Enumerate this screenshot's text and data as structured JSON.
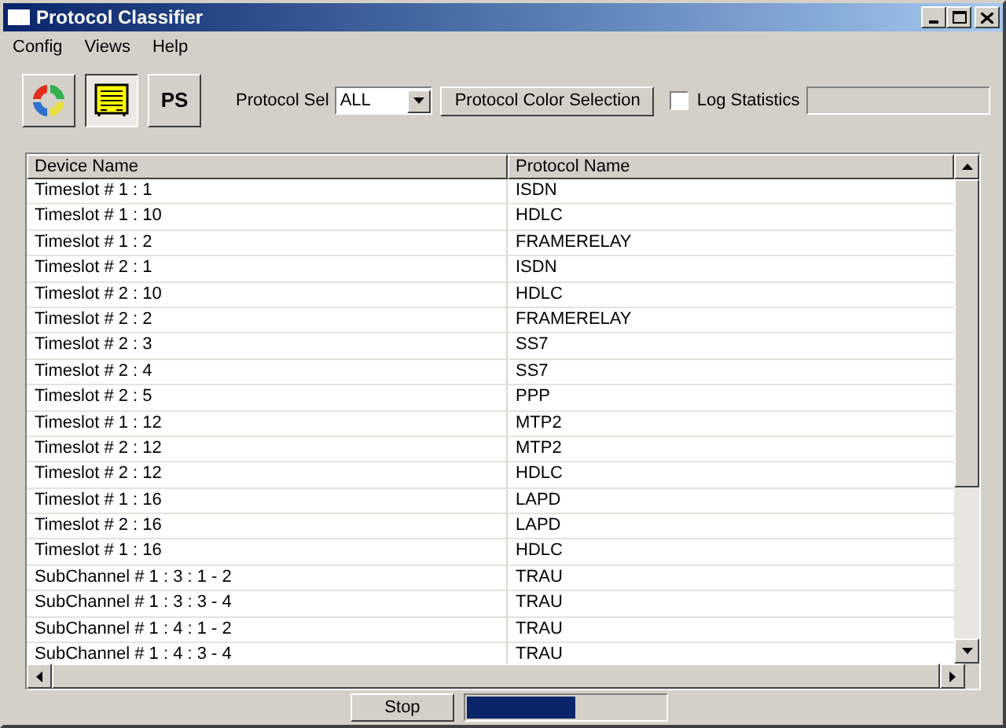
{
  "window": {
    "title": "Protocol Classifier"
  },
  "menu": [
    "Config",
    "Views",
    "Help"
  ],
  "toolbar": {
    "tools": [
      {
        "kind": "cycle",
        "selected": false
      },
      {
        "kind": "list",
        "selected": true
      },
      {
        "kind": "text",
        "label": "PS",
        "selected": false
      }
    ],
    "protocol_sel": {
      "label": "Protocol Sel",
      "value": "ALL"
    },
    "color_button": "Protocol Color Selection",
    "log_statistics": {
      "label": "Log Statistics",
      "checked": false
    }
  },
  "table": {
    "columns": [
      "Device Name",
      "Protocol Name"
    ],
    "rows": [
      [
        "Timeslot # 1 : 1",
        "ISDN"
      ],
      [
        "Timeslot # 1 : 10",
        "HDLC"
      ],
      [
        "Timeslot # 1 : 2",
        "FRAMERELAY"
      ],
      [
        "Timeslot # 2 : 1",
        "ISDN"
      ],
      [
        "Timeslot # 2 : 10",
        "HDLC"
      ],
      [
        "Timeslot # 2 : 2",
        "FRAMERELAY"
      ],
      [
        "Timeslot # 2 : 3",
        "SS7"
      ],
      [
        "Timeslot # 2 : 4",
        "SS7"
      ],
      [
        "Timeslot # 2 : 5",
        "PPP"
      ],
      [
        "Timeslot # 1 : 12",
        "MTP2"
      ],
      [
        "Timeslot # 2 : 12",
        "MTP2"
      ],
      [
        "Timeslot # 2 : 12",
        "HDLC"
      ],
      [
        "Timeslot # 1 : 16",
        "LAPD"
      ],
      [
        "Timeslot # 2 : 16",
        "LAPD"
      ],
      [
        "Timeslot # 1 : 16",
        "HDLC"
      ],
      [
        "SubChannel # 1 : 3 : 1 - 2",
        "TRAU"
      ],
      [
        "SubChannel # 1 : 3 : 3 - 4",
        "TRAU"
      ],
      [
        "SubChannel # 1 : 4 : 1 - 2",
        "TRAU"
      ],
      [
        "SubChannel # 1 : 4 : 3 - 4",
        "TRAU"
      ]
    ]
  },
  "stop_button": "Stop",
  "progress": {
    "level": 0.55
  }
}
